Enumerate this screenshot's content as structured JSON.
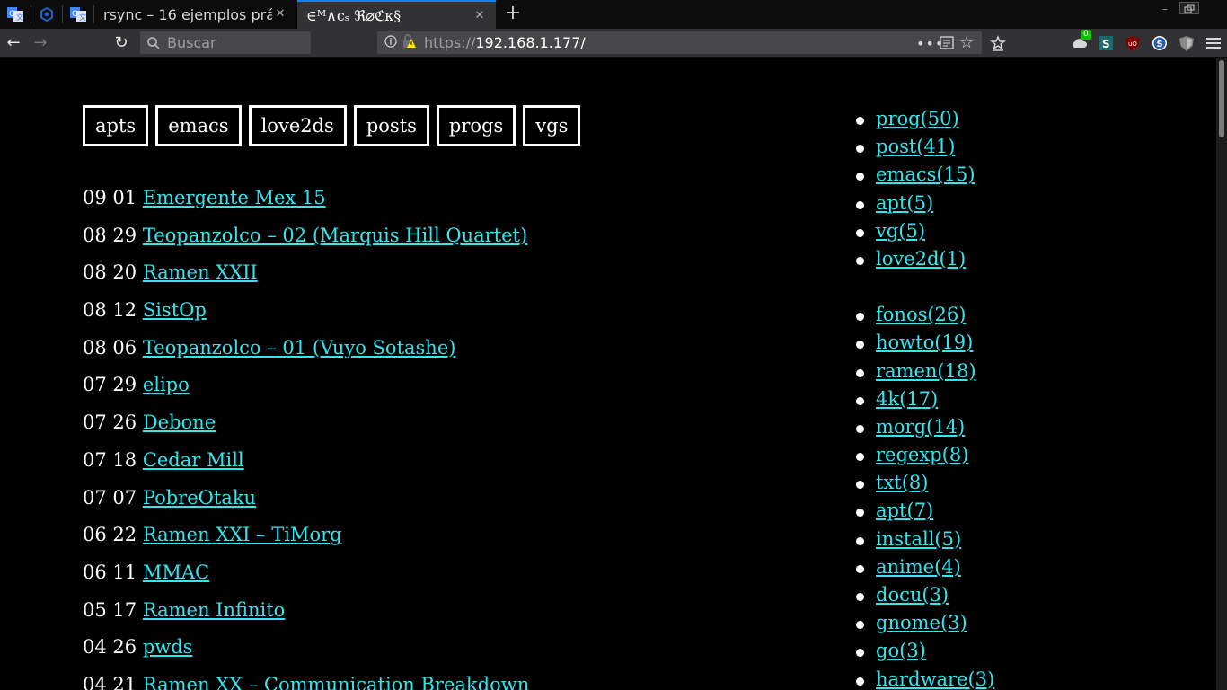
{
  "browser": {
    "tabs": [
      {
        "title": "rsync – 16 ejemplos prá",
        "active": false
      },
      {
        "title": "∈ᴹ∧cₛ ℜ⌀ℭκ§",
        "active": true
      }
    ],
    "new_tab_label": "+",
    "search_placeholder": "Buscar",
    "url_prefix": "https://",
    "url_host": "192.168.1.177/",
    "notification_badge": "0",
    "accent_color": "#0a84ff"
  },
  "page": {
    "categories": [
      "apts",
      "emacs",
      "love2ds",
      "posts",
      "progs",
      "vgs"
    ],
    "posts": [
      {
        "date": "09 01",
        "title": "Emergente Mex 15"
      },
      {
        "date": "08 29",
        "title": "Teopanzolco – 02 (Marquis Hill Quartet)"
      },
      {
        "date": "08 20",
        "title": "Ramen XXII"
      },
      {
        "date": "08 12",
        "title": "SistOp"
      },
      {
        "date": "08 06",
        "title": "Teopanzolco – 01 (Vuyo Sotashe)"
      },
      {
        "date": "07 29",
        "title": "elipo"
      },
      {
        "date": "07 26",
        "title": "Debone"
      },
      {
        "date": "07 18",
        "title": "Cedar Mill"
      },
      {
        "date": "07 07",
        "title": "PobreOtaku"
      },
      {
        "date": "06 22",
        "title": "Ramen XXI – TiMorg"
      },
      {
        "date": "06 11",
        "title": "MMAC"
      },
      {
        "date": "05 17",
        "title": "Ramen Infinito"
      },
      {
        "date": "04 26",
        "title": "pwds"
      },
      {
        "date": "04 21",
        "title": "Ramen XX – Communication Breakdown"
      }
    ],
    "category_counts": [
      "prog(50)",
      "post(41)",
      "emacs(15)",
      "apt(5)",
      "vg(5)",
      "love2d(1)"
    ],
    "tag_counts": [
      "fonos(26)",
      "howto(19)",
      "ramen(18)",
      "4k(17)",
      "morg(14)",
      "regexp(8)",
      "txt(8)",
      "apt(7)",
      "install(5)",
      "anime(4)",
      "docu(3)",
      "gnome(3)",
      "go(3)",
      "hardware(3)"
    ],
    "link_color": "#33e6ee",
    "background_color": "#000000"
  }
}
